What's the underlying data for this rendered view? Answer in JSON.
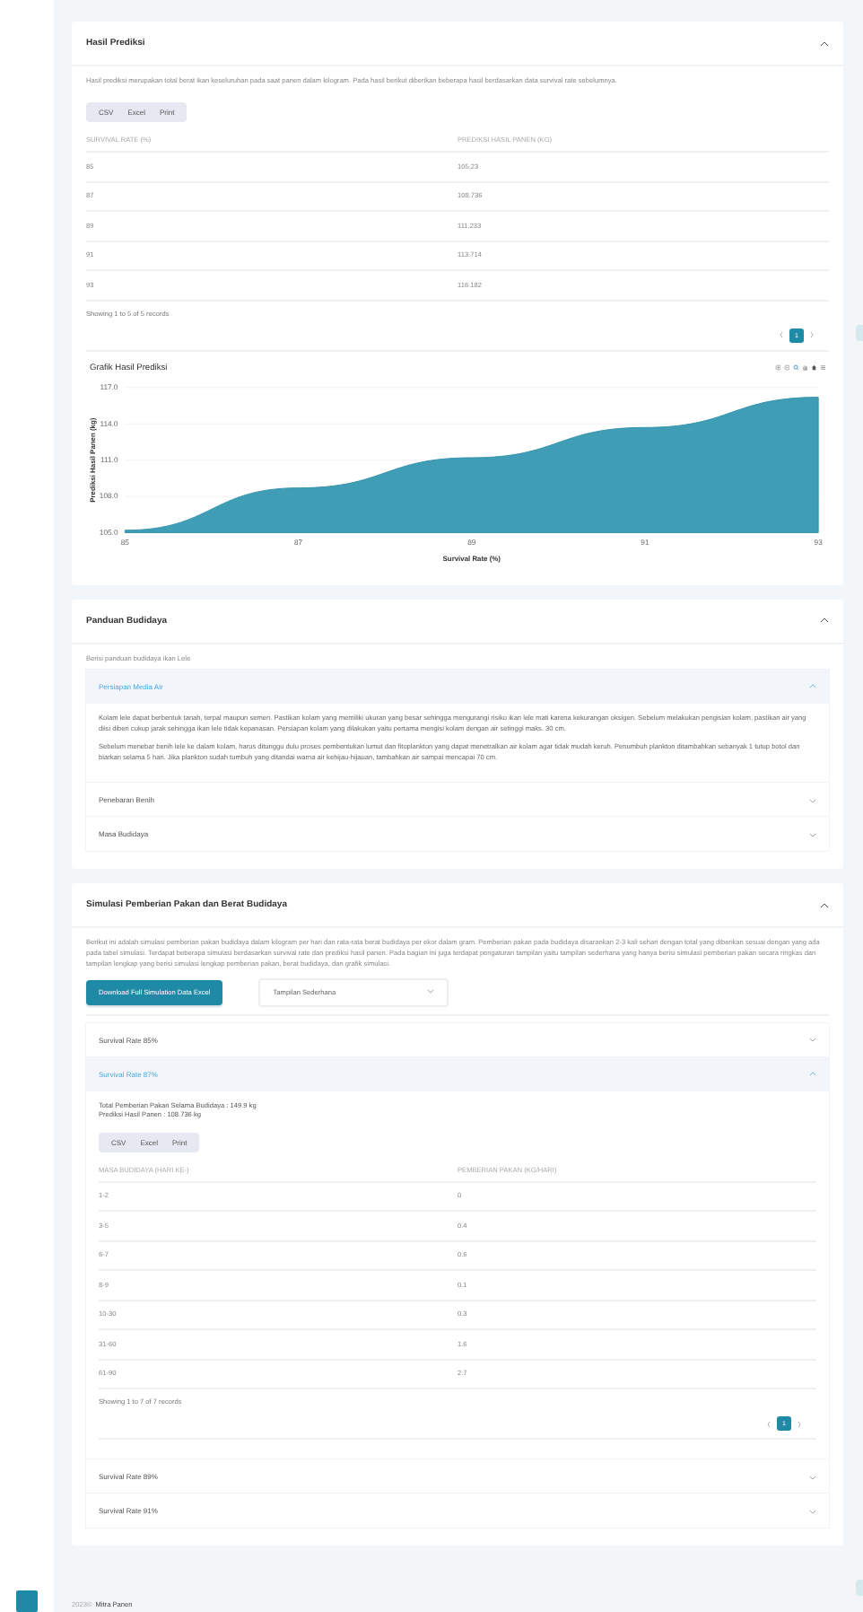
{
  "prediction": {
    "title": "Hasil Prediksi",
    "expanded": true,
    "description": "Hasil prediksi merupakan total berat ikan keseluruhan pada saat panen dalam kilogram. Pada hasil berikut diberikan beberapa hasil berdasarkan data survival rate sebelumnya.",
    "export_buttons": [
      "CSV",
      "Excel",
      "Print"
    ],
    "table": {
      "columns": [
        "SURVIVAL RATE (%)",
        "PREDIKSI HASIL PANEN (KG)"
      ],
      "rows": [
        [
          "85",
          "105.23"
        ],
        [
          "87",
          "108.736"
        ],
        [
          "89",
          "111.233"
        ],
        [
          "91",
          "113.714"
        ],
        [
          "93",
          "116.182"
        ]
      ]
    },
    "records": "Showing 1 to 5 of 5 records",
    "pages": [
      {
        "label": "1",
        "selected": true
      }
    ],
    "chart_title": "Grafik Hasil Prediksi",
    "chart_data": {
      "type": "area",
      "grid": true,
      "xlabel": "Survival Rate (%)",
      "ylabel": "Prediksi Hasil Panen (kg)",
      "x": [
        85,
        87,
        89,
        91,
        93
      ],
      "series": [
        {
          "color": "#3f9db5",
          "values": [
            105.2,
            108.7,
            111.2,
            113.7,
            116.2
          ]
        }
      ],
      "xlim": [
        85,
        93
      ],
      "ylim": [
        105,
        117
      ],
      "xticks": [
        85,
        87,
        89,
        91,
        93
      ],
      "yticks": [
        {
          "value": 105,
          "label": "105.0"
        },
        {
          "value": 108,
          "label": "108.0"
        },
        {
          "value": 111,
          "label": "111.0"
        },
        {
          "value": 114,
          "label": "114.0"
        },
        {
          "value": 117,
          "label": "117.0"
        }
      ]
    }
  },
  "guide": {
    "title": "Panduan Budidaya",
    "expanded": true,
    "description": "Berisi panduan budidaya ikan Lele",
    "items": [
      {
        "title": "Persiapan Media Air",
        "expanded": true,
        "paragraphs": [
          "Kolam lele dapat berbentuk tanah, terpal maupun semen. Pastikan kolam yang memiliki ukuran yang besar sehingga mengurangi risiko ikan lele mati karena kekurangan oksigen. Sebelum melakukan pengisian kolam, pastikan air yang diisi diberi cukup jarak sehingga ikan lele tidak kepanasan. Persiapan kolam yang dilakukan yaitu pertama mengisi kolam dengan air setinggi maks. 30 cm.",
          "Sebelum menebar benih lele ke dalam kolam, harus ditunggu dulu proses pembentukan lumut dan fitoplankton yang dapat menetralkan air kolam agar tidak mudah keruh. Penumbuh plankton ditambahkan sebanyak 1 tutup botol dan biarkan selama 5 hari. Jika plankton sudah tumbuh yang ditandai warna air kehijau-hijauan, tambahkan air sampai mencapai 70 cm."
        ]
      },
      {
        "title": "Penebaran Benih",
        "expanded": false
      },
      {
        "title": "Masa Budidaya",
        "expanded": false
      }
    ]
  },
  "simulation": {
    "title": "Simulasi Pemberian Pakan dan Berat Budidaya",
    "expanded": true,
    "description": "Berikut ini adalah simulasi pemberian pakan budidaya dalam kilogram per hari dan rata-rata berat budidaya per ekor dalam gram. Pemberian pakan pada budidaya disarankan 2-3 kali sehari dengan total yang diberikan sesuai dengan yang ada pada tabel simulasi. Terdapat beberapa simulasi berdasarkan survival rate dan prediksi hasil panen. Pada bagian ini juga terdapat pengaturan tampilan yaitu tampilan sederhana yang hanya berisi simulasi pemberian pakan secara ringkas dan tampilan lengkap yang berisi simulasi lengkap pemberian pakan, berat budidaya, dan grafik simulasi.",
    "download_button": "Download Full Simulation Data Excel",
    "view_select": "Tampilan Sederhana",
    "items": [
      {
        "title": "Survival Rate 85%",
        "expanded": false
      },
      {
        "title": "Survival Rate 87%",
        "expanded": true,
        "summary": [
          "Total Pemberian Pakan Selama Budidaya : 149.9 kg",
          "Prediksi Hasil Panen : 108.736 kg"
        ],
        "export_buttons": [
          "CSV",
          "Excel",
          "Print"
        ],
        "table": {
          "columns": [
            "MASA BUDIDAYA (HARI KE-)",
            "PEMBERIAN PAKAN (KG/HARI)"
          ],
          "rows": [
            [
              "1-2",
              "0"
            ],
            [
              "3-5",
              "0.4"
            ],
            [
              "6-7",
              "0.6"
            ],
            [
              "8-9",
              "0.1"
            ],
            [
              "10-30",
              "0.3"
            ],
            [
              "31-60",
              "1.6"
            ],
            [
              "61-90",
              "2.7"
            ]
          ]
        },
        "records": "Showing 1 to 7 of 7 records",
        "pages": [
          {
            "label": "1",
            "selected": true
          }
        ]
      },
      {
        "title": "Survival Rate 89%",
        "expanded": false
      },
      {
        "title": "Survival Rate 91%",
        "expanded": false
      }
    ]
  },
  "footer": {
    "year": "2023©",
    "brand": "Mitra Panen"
  }
}
